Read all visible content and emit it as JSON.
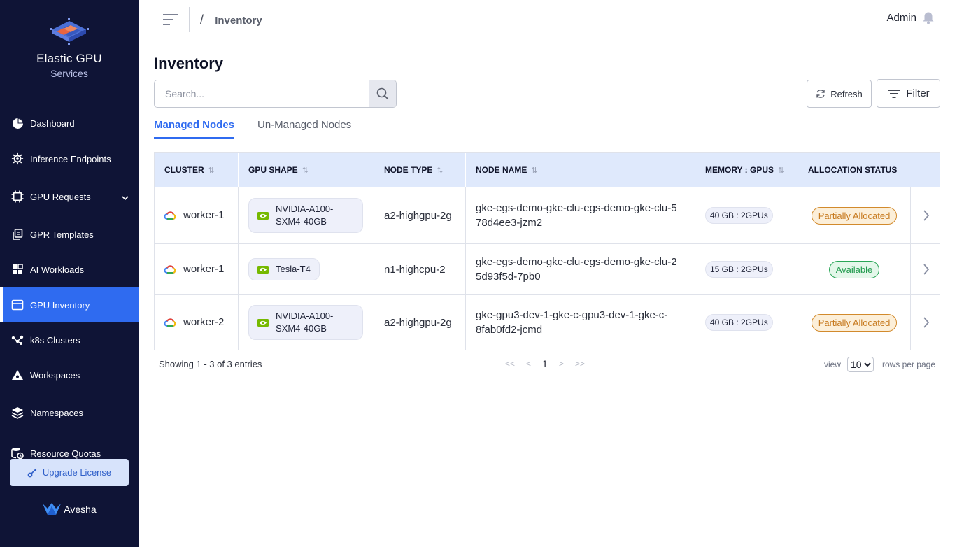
{
  "brand": {
    "name_line1": "Elastic GPU",
    "name_line2": "Services",
    "footer": "Avesha"
  },
  "sidebar": {
    "items": [
      {
        "label": "Dashboard",
        "icon": "pie-chart-icon"
      },
      {
        "label": "Inference Endpoints",
        "icon": "gear-network-icon"
      },
      {
        "label": "GPU Requests",
        "icon": "chip-icon",
        "has_submenu": true
      },
      {
        "label": "GPR Templates",
        "icon": "copy-icon"
      },
      {
        "label": "AI Workloads",
        "icon": "grid-icon"
      },
      {
        "label": "GPU Inventory",
        "icon": "inventory-icon",
        "active": true
      },
      {
        "label": "k8s Clusters",
        "icon": "cluster-icon"
      },
      {
        "label": "Workspaces",
        "icon": "workspace-icon"
      },
      {
        "label": "Namespaces",
        "icon": "layers-icon"
      },
      {
        "label": "Resource Quotas",
        "icon": "database-clock-icon"
      }
    ],
    "upgrade_label": "Upgrade License"
  },
  "header": {
    "breadcrumb_sep": "/",
    "breadcrumb": "Inventory",
    "user": "Admin"
  },
  "page": {
    "title": "Inventory",
    "search_placeholder": "Search...",
    "refresh_label": "Refresh",
    "filter_label": "Filter",
    "tabs": [
      {
        "label": "Managed Nodes",
        "active": true
      },
      {
        "label": "Un-Managed Nodes",
        "active": false
      }
    ]
  },
  "table": {
    "columns": [
      {
        "label": "CLUSTER",
        "sortable": true
      },
      {
        "label": "GPU SHAPE",
        "sortable": true
      },
      {
        "label": "NODE TYPE",
        "sortable": true
      },
      {
        "label": "NODE NAME",
        "sortable": true
      },
      {
        "label": "MEMORY : GPUS",
        "sortable": true
      },
      {
        "label": "ALLOCATION STATUS",
        "sortable": false
      }
    ],
    "sort_glyph": "⇅",
    "rows": [
      {
        "cluster": "worker-1",
        "gpu_shape": "NVIDIA-A100-SXM4-40GB",
        "node_type": "a2-highgpu-2g",
        "node_name": "gke-egs-demo-gke-clu-egs-demo-gke-clu-578d4ee3-jzm2",
        "memory_gpus": "40 GB : 2GPUs",
        "status": "Partially Allocated",
        "status_kind": "partial"
      },
      {
        "cluster": "worker-1",
        "gpu_shape": "Tesla-T4",
        "node_type": "n1-highcpu-2",
        "node_name": "gke-egs-demo-gke-clu-egs-demo-gke-clu-25d93f5d-7pb0",
        "memory_gpus": "15 GB : 2GPUs",
        "status": "Available",
        "status_kind": "available"
      },
      {
        "cluster": "worker-2",
        "gpu_shape": "NVIDIA-A100-SXM4-40GB",
        "node_type": "a2-highgpu-2g",
        "node_name": "gke-gpu3-dev-1-gke-c-gpu3-dev-1-gke-c-8fab0fd2-jcmd",
        "memory_gpus": "40 GB : 2GPUs",
        "status": "Partially Allocated",
        "status_kind": "partial"
      }
    ]
  },
  "pagination": {
    "showing": "Showing 1 - 3 of 3 entries",
    "first": "<<",
    "prev": "<",
    "current": "1",
    "next": ">",
    "last": ">>",
    "view_label": "view",
    "rows_per_page": "10",
    "rows_label": "rows per page"
  },
  "colors": {
    "sidebar_bg": "#0f1436",
    "accent": "#2f6bf0",
    "table_header": "#dfe9fc",
    "partial": "#c77a1f",
    "available": "#1f9a4c"
  }
}
